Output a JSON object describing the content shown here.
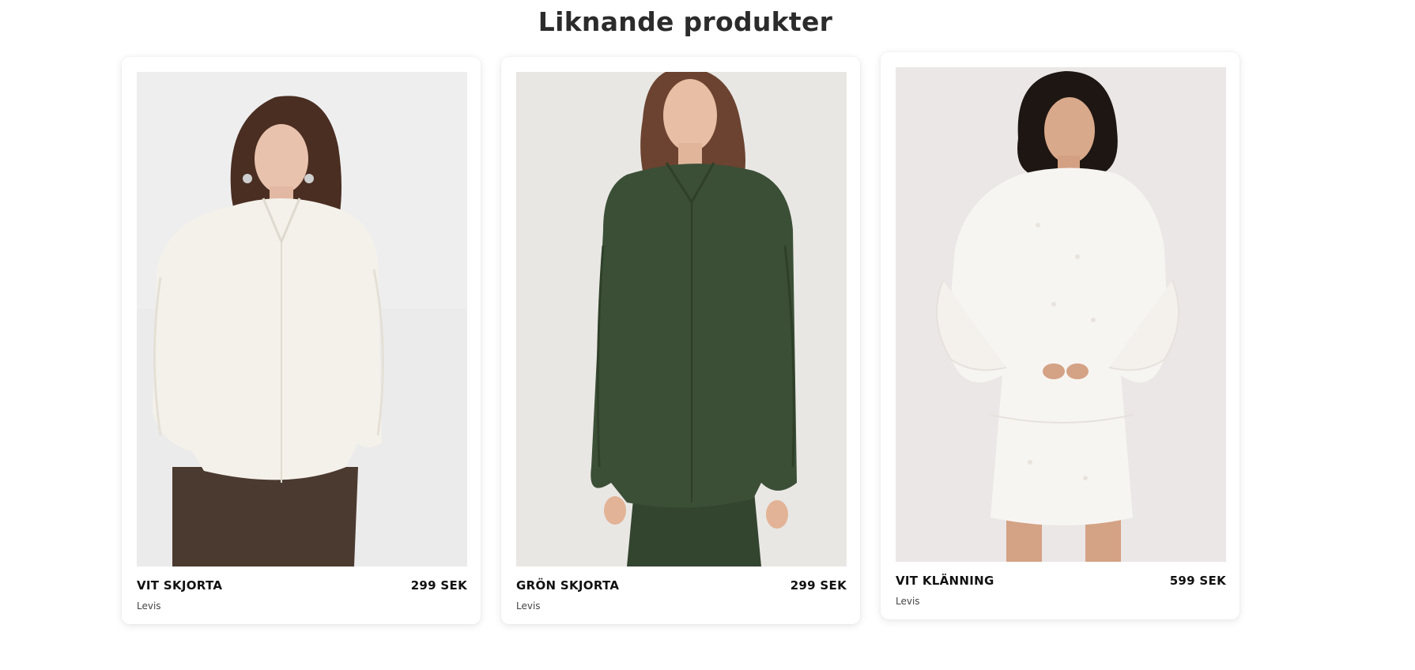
{
  "section": {
    "title": "Liknande produkter"
  },
  "products": [
    {
      "name": "VIT SKJORTA",
      "price": "299 SEK",
      "brand": "Levis",
      "image_desc": "woman in white satin shirt and brown trousers"
    },
    {
      "name": "GRÖN SKJORTA",
      "price": "299 SEK",
      "brand": "Levis",
      "image_desc": "woman in dark green shirt and skirt"
    },
    {
      "name": "VIT KLÄNNING",
      "price": "599 SEK",
      "brand": "Levis",
      "image_desc": "woman in white embroidered dress"
    }
  ],
  "colors": {
    "card_background": "#ffffff",
    "title_text": "#2b2b2b",
    "shirt_white": "#f3f0e8",
    "shirt_green": "#3a4d36",
    "dress_white": "#f7f5f2",
    "photo_background": "#ecebea"
  }
}
